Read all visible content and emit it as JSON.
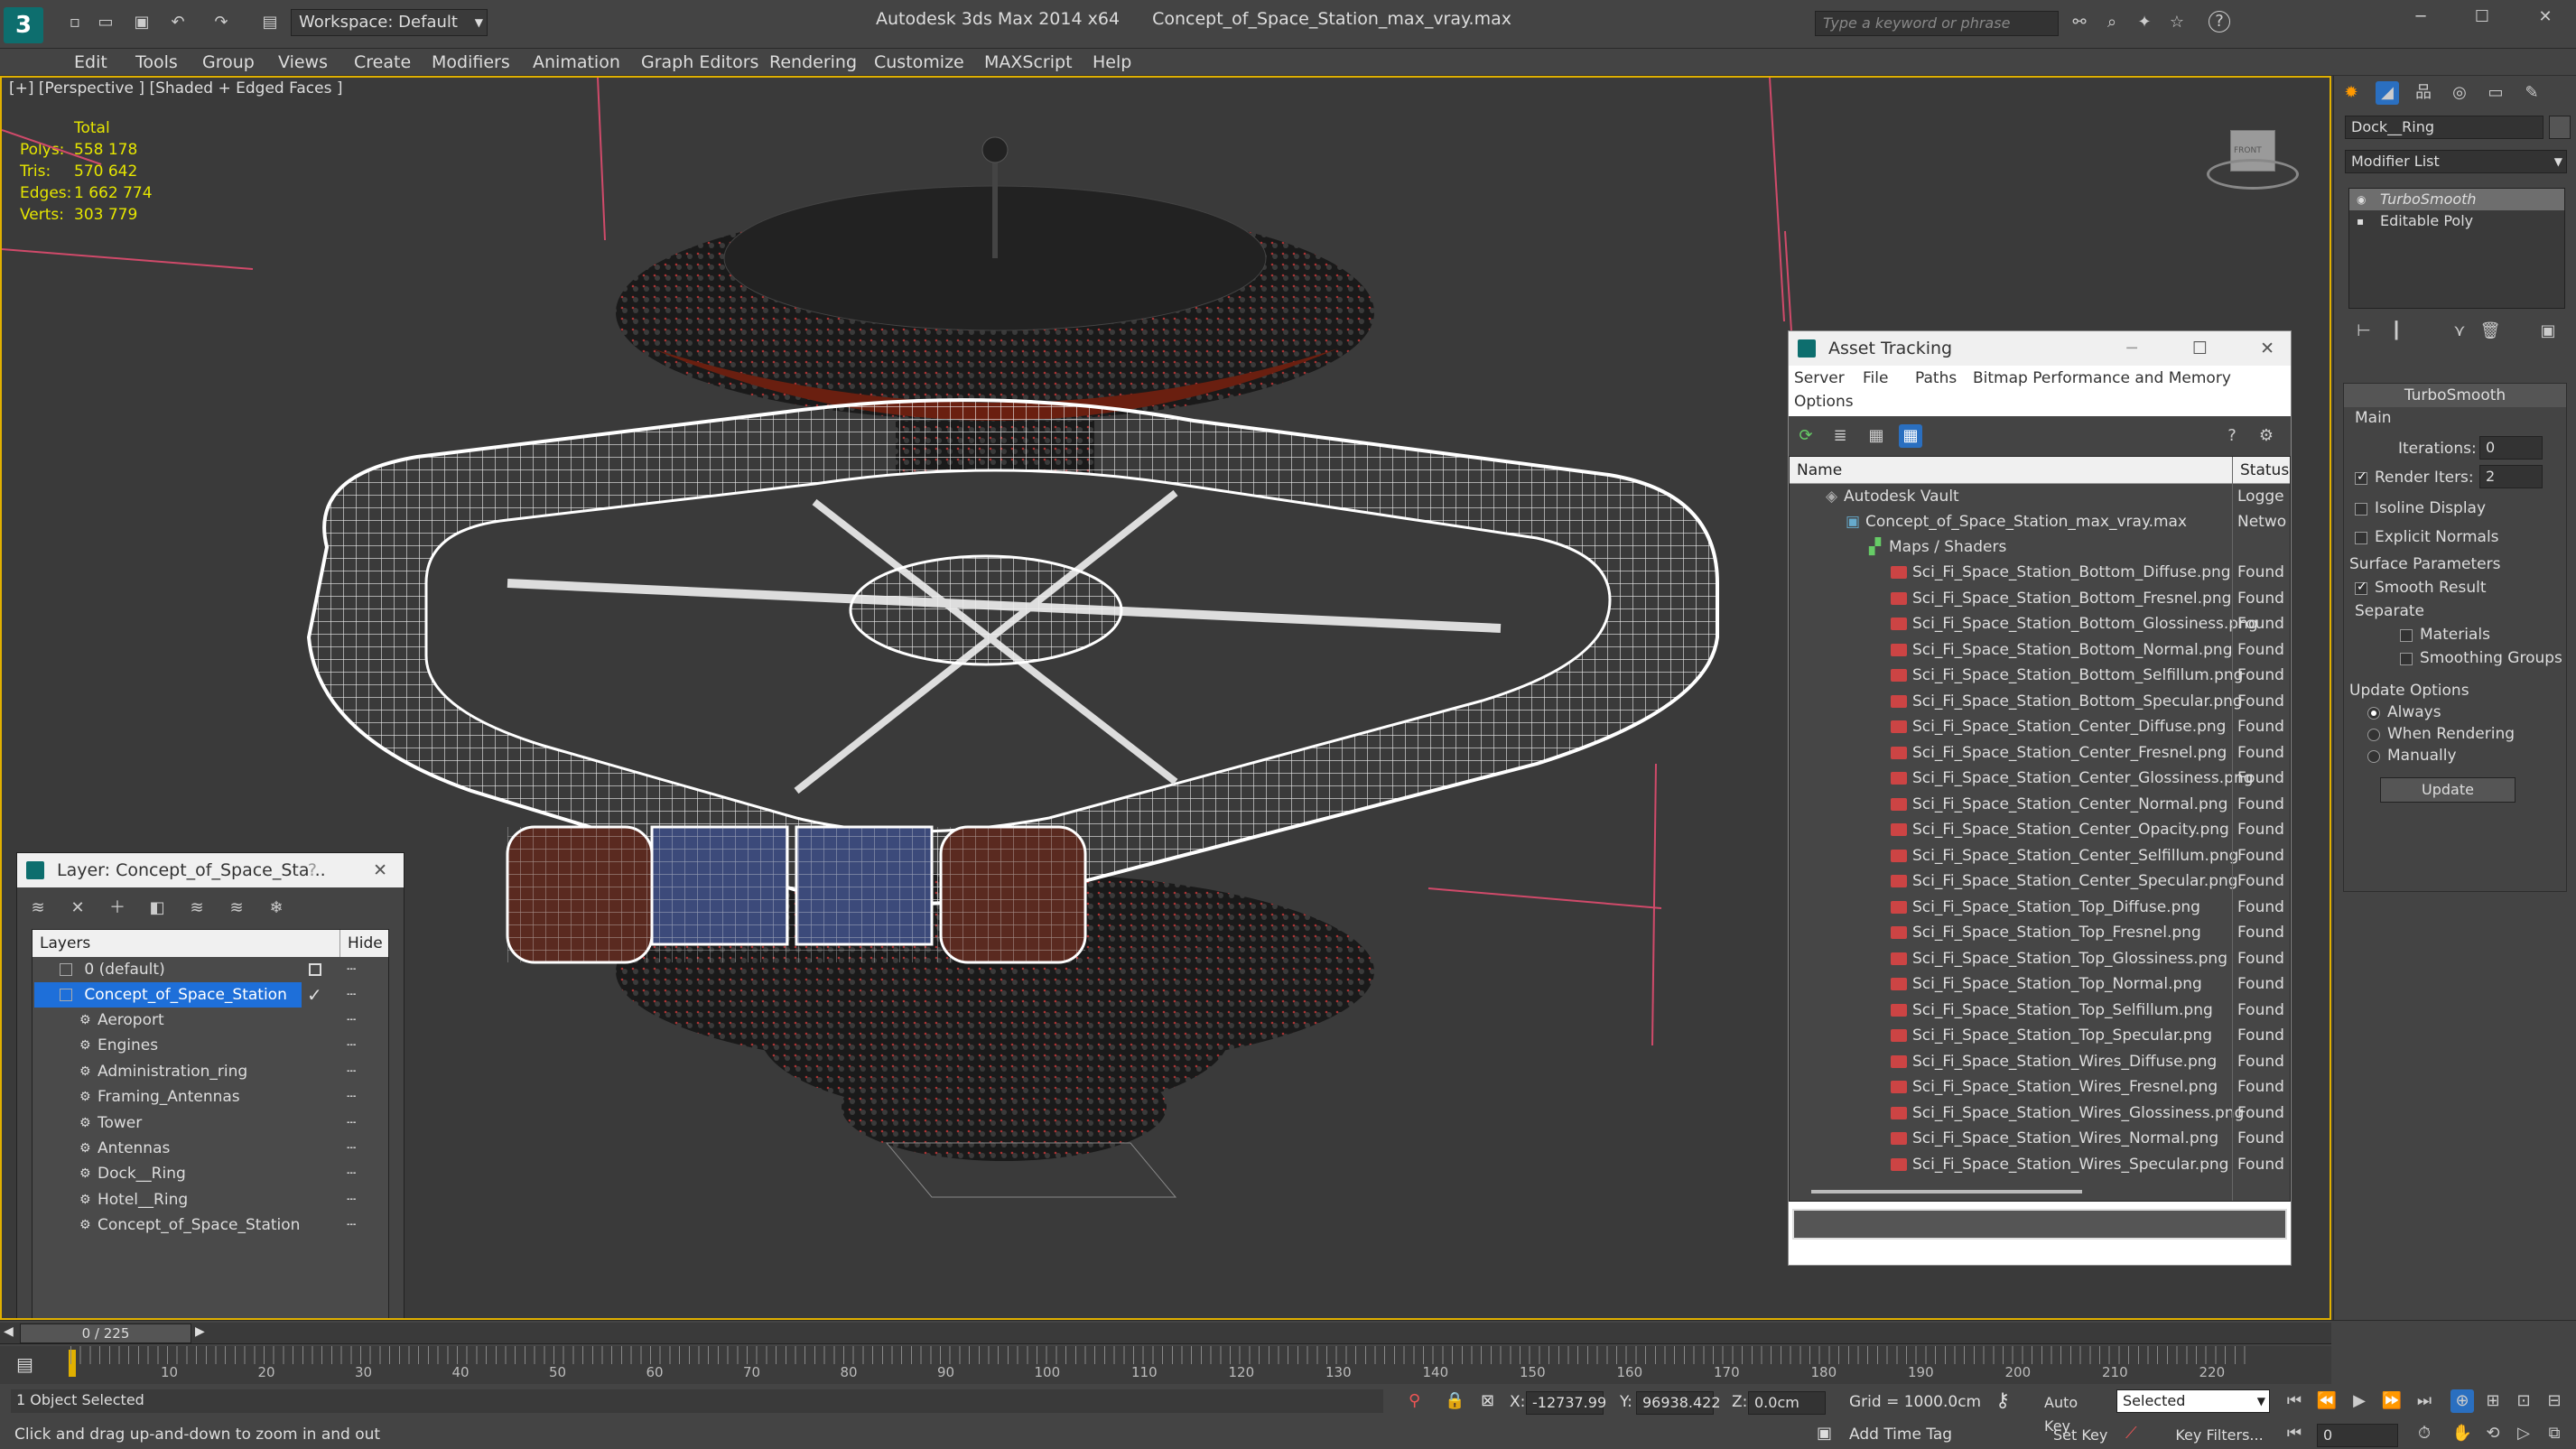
{
  "title": {
    "app": "Autodesk 3ds Max  2014 x64",
    "file": "Concept_of_Space_Station_max_vray.max",
    "workspace": "Workspace: Default",
    "search_placeholder": "Type a keyword or phrase"
  },
  "menu": [
    "Edit",
    "Tools",
    "Group",
    "Views",
    "Create",
    "Modifiers",
    "Animation",
    "Graph Editors",
    "Rendering",
    "Customize",
    "MAXScript",
    "Help"
  ],
  "viewport": {
    "label": "[+] [Perspective ] [Shaded + Edged Faces ]",
    "stats": {
      "header": "Total",
      "polys_label": "Polys:",
      "polys": "558 178",
      "tris_label": "Tris:",
      "tris": "570 642",
      "edges_label": "Edges:",
      "edges": "1 662 774",
      "verts_label": "Verts:",
      "verts": "303 779"
    },
    "viewcube": "FRONT"
  },
  "asset_tracking": {
    "title": "Asset Tracking",
    "menu": [
      "Server",
      "File",
      "Paths",
      "Bitmap Performance and Memory",
      "Options"
    ],
    "col_name": "Name",
    "col_status": "Status",
    "vault": {
      "name": "Autodesk Vault",
      "status": "Logge"
    },
    "file": {
      "name": "Concept_of_Space_Station_max_vray.max",
      "status": "Netwo"
    },
    "maps": {
      "name": "Maps / Shaders"
    },
    "found_status": "Found",
    "files": [
      "Sci_Fi_Space_Station_Bottom_Diffuse.png",
      "Sci_Fi_Space_Station_Bottom_Fresnel.png",
      "Sci_Fi_Space_Station_Bottom_Glossiness.png",
      "Sci_Fi_Space_Station_Bottom_Normal.png",
      "Sci_Fi_Space_Station_Bottom_Selfillum.png",
      "Sci_Fi_Space_Station_Bottom_Specular.png",
      "Sci_Fi_Space_Station_Center_Diffuse.png",
      "Sci_Fi_Space_Station_Center_Fresnel.png",
      "Sci_Fi_Space_Station_Center_Glossiness.png",
      "Sci_Fi_Space_Station_Center_Normal.png",
      "Sci_Fi_Space_Station_Center_Opacity.png",
      "Sci_Fi_Space_Station_Center_Selfillum.png",
      "Sci_Fi_Space_Station_Center_Specular.png",
      "Sci_Fi_Space_Station_Top_Diffuse.png",
      "Sci_Fi_Space_Station_Top_Fresnel.png",
      "Sci_Fi_Space_Station_Top_Glossiness.png",
      "Sci_Fi_Space_Station_Top_Normal.png",
      "Sci_Fi_Space_Station_Top_Selfillum.png",
      "Sci_Fi_Space_Station_Top_Specular.png",
      "Sci_Fi_Space_Station_Wires_Diffuse.png",
      "Sci_Fi_Space_Station_Wires_Fresnel.png",
      "Sci_Fi_Space_Station_Wires_Glossiness.png",
      "Sci_Fi_Space_Station_Wires_Normal.png",
      "Sci_Fi_Space_Station_Wires_Specular.png"
    ]
  },
  "layer_panel": {
    "title": "Layer: Concept_of_Space_Sta...",
    "help": "?",
    "col_layers": "Layers",
    "col_hide": "Hide",
    "default_layer": "0 (default)",
    "active_layer": "Concept_of_Space_Station",
    "children": [
      "Aeroport",
      "Engines",
      "Administration_ring",
      "Framing_Antennas",
      "Tower",
      "Antennas",
      "Dock__Ring",
      "Hotel__Ring",
      "Concept_of_Space_Station"
    ]
  },
  "command_panel": {
    "object_name": "Dock__Ring",
    "modifier_list": "Modifier List",
    "stack": [
      "TurboSmooth",
      "Editable Poly"
    ],
    "rollout": "TurboSmooth",
    "main": "Main",
    "iterations_label": "Iterations:",
    "iterations": "0",
    "render_iters_label": "Render Iters:",
    "render_iters": "2",
    "isoline": "Isoline Display",
    "explicit": "Explicit Normals",
    "surface": "Surface Parameters",
    "smooth_result": "Smooth Result",
    "separate": "Separate",
    "materials": "Materials",
    "smoothing_groups": "Smoothing Groups",
    "update_options": "Update Options",
    "always": "Always",
    "when_rendering": "When Rendering",
    "manually": "Manually",
    "update_btn": "Update"
  },
  "timeline": {
    "frame": "0 / 225",
    "ticks": [
      "10",
      "20",
      "30",
      "40",
      "50",
      "60",
      "70",
      "80",
      "90",
      "100",
      "110",
      "120",
      "130",
      "140",
      "150",
      "160",
      "170",
      "180",
      "190",
      "200",
      "210",
      "220"
    ]
  },
  "status": {
    "selected": "1 Object Selected",
    "prompt": "Click and drag up-and-down to zoom in and out",
    "x_label": "X:",
    "x": "-12737.99",
    "y_label": "Y:",
    "y": "96938.422",
    "z_label": "Z:",
    "z": "0.0cm",
    "grid": "Grid = 1000.0cm",
    "auto_key": "Auto Key",
    "selected_dd": "Selected",
    "set_key": "Set Key",
    "key_filters": "Key Filters...",
    "add_time_tag": "Add Time Tag",
    "frame_field": "0"
  },
  "colors": {
    "accent": "#e0b000",
    "select": "#1e6fd9",
    "stats": "#e6e600"
  }
}
